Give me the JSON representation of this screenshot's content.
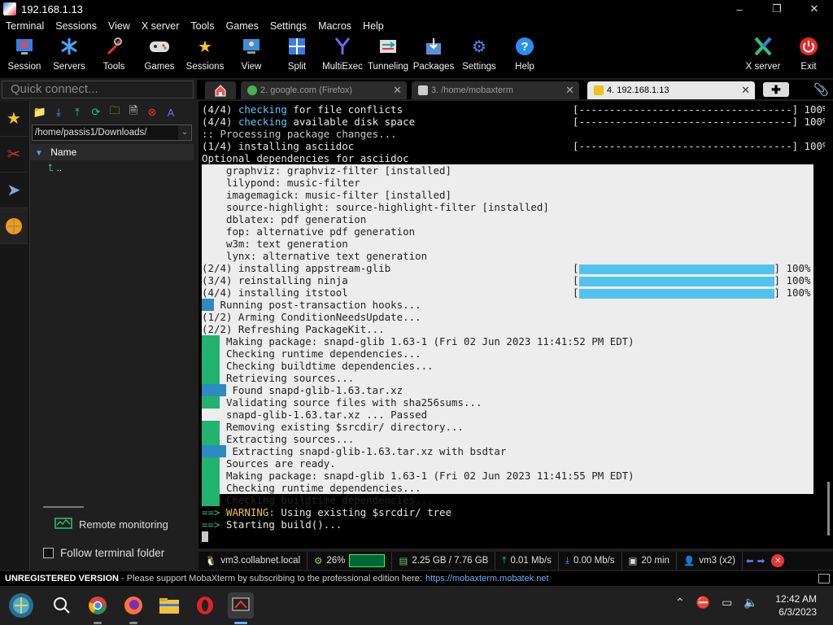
{
  "window": {
    "title": "192.168.1.13",
    "controls": [
      "–",
      "❐",
      "✕"
    ]
  },
  "menu": [
    "Terminal",
    "Sessions",
    "View",
    "X server",
    "Tools",
    "Games",
    "Settings",
    "Macros",
    "Help"
  ],
  "toolbar": {
    "left": [
      {
        "label": "Session",
        "icon": "session-icon"
      },
      {
        "label": "Servers",
        "icon": "servers-icon"
      },
      {
        "label": "Tools",
        "icon": "tools-icon"
      },
      {
        "label": "Games",
        "icon": "games-icon"
      },
      {
        "label": "Sessions",
        "icon": "sessions-star-icon"
      },
      {
        "label": "View",
        "icon": "view-icon"
      },
      {
        "label": "Split",
        "icon": "split-icon"
      },
      {
        "label": "MultiExec",
        "icon": "multiexec-icon"
      },
      {
        "label": "Tunneling",
        "icon": "tunneling-icon"
      },
      {
        "label": "Packages",
        "icon": "packages-icon"
      },
      {
        "label": "Settings",
        "icon": "settings-icon"
      },
      {
        "label": "Help",
        "icon": "help-icon"
      }
    ],
    "right": [
      {
        "label": "X server",
        "icon": "xserver-icon"
      },
      {
        "label": "Exit",
        "icon": "exit-icon"
      }
    ]
  },
  "quick_connect": {
    "placeholder": "Quick connect..."
  },
  "tabs": [
    {
      "label": "2. google.com (Firefox)",
      "active": false
    },
    {
      "label": "3. /home/mobaxterm",
      "active": false
    },
    {
      "label": "4. 192.168.1.13",
      "active": true
    }
  ],
  "file_panel": {
    "path": "/home/passis1/Downloads/",
    "column": "Name",
    "rows": [
      ".."
    ],
    "remote_monitoring": "Remote monitoring",
    "follow_folder": "Follow terminal folder"
  },
  "terminal": {
    "lines": [
      {
        "pre": "(4/4) ",
        "hl": "checking",
        "post": " for file conflicts",
        "bar": "[-----------------------------------] 100%"
      },
      {
        "pre": "(4/4) ",
        "hl": "checking",
        "post": " available disk space",
        "bar": "[-----------------------------------] 100%"
      },
      {
        "text": ":: Processing package changes...",
        "cls": "c-dim-colon"
      },
      {
        "text": "(1/4) installing asciidoc",
        "bar": "[-----------------------------------] 100%"
      },
      {
        "text": "Optional dependencies for asciidoc"
      },
      {
        "text": "    graphviz: graphviz-filter [installed]"
      },
      {
        "text": "    lilypond: music-filter"
      },
      {
        "text": "    imagemagick: music-filter [installed]"
      },
      {
        "text": "    source-highlight: source-highlight-filter [installed]"
      },
      {
        "text": "    dblatex: pdf generation"
      },
      {
        "text": "    fop: alternative pdf generation"
      },
      {
        "text": "    w3m: text generation"
      },
      {
        "text": "    lynx: alternative text generation"
      },
      {
        "text": "(2/4) installing appstream-glib",
        "bar": "[-----------------------------------] 100%",
        "fill": true
      },
      {
        "text": "(3/4) reinstalling ninja",
        "bar": "[-----------------------------------] 100%",
        "fill": true
      },
      {
        "text": "(4/4) installing itstool",
        "bar": "[-----------------------------------] 100%",
        "fill": true
      },
      {
        "text": ":: Running post-transaction hooks...",
        "prefix": "::"
      },
      {
        "text": "(1/2) Arming ConditionNeedsUpdate..."
      },
      {
        "text": "(2/2) Refreshing PackageKit..."
      },
      {
        "arrow": "==>",
        "text": " Making package: snapd-glib 1.63-1 (Fri 02 Jun 2023 11:41:52 PM EDT)"
      },
      {
        "arrow": "==>",
        "text": " Checking runtime dependencies..."
      },
      {
        "arrow": "==>",
        "text": " Checking buildtime dependencies..."
      },
      {
        "arrow": "==>",
        "text": " Retrieving sources..."
      },
      {
        "arrow2": "  ->",
        "text": " Found snapd-glib-1.63.tar.xz"
      },
      {
        "arrow": "==>",
        "text": " Validating source files with sha256sums..."
      },
      {
        "text": "    snapd-glib-1.63.tar.xz ... Passed"
      },
      {
        "arrow": "==>",
        "text": " Removing existing $srcdir/ directory..."
      },
      {
        "arrow": "==>",
        "text": " Extracting sources..."
      },
      {
        "arrow2": "  ->",
        "text": " Extracting snapd-glib-1.63.tar.xz with bsdtar"
      },
      {
        "arrow": "==>",
        "text": " Sources are ready."
      },
      {
        "arrow": "==>",
        "text": " Making package: snapd-glib 1.63-1 (Fri 02 Jun 2023 11:41:55 PM EDT)"
      },
      {
        "arrow": "==>",
        "text": " Checking runtime dependencies..."
      },
      {
        "arrow": "==>",
        "text": " Checking buildtime dependencies..."
      },
      {
        "warn_arrow": "==>",
        "warn": " WARNING:",
        "text": " Using existing $srcdir/ tree"
      },
      {
        "warn_arrow": "==>",
        "text": " Starting build()..."
      }
    ]
  },
  "status": {
    "host": "vm3.collabnet.local",
    "cpu": "26%",
    "mem": "2.25 GB / 7.76 GB",
    "up": "0.01 Mb/s",
    "down": "0.00 Mb/s",
    "time": "20 min",
    "user": "vm3 (x2)"
  },
  "unregistered": {
    "bold": "UNREGISTERED VERSION",
    "msg": " - Please support MobaXterm by subscribing to the professional edition here:",
    "link": "https://mobaxterm.mobatek.net"
  },
  "clock": {
    "time": "12:42 AM",
    "date": "6/3/2023"
  }
}
